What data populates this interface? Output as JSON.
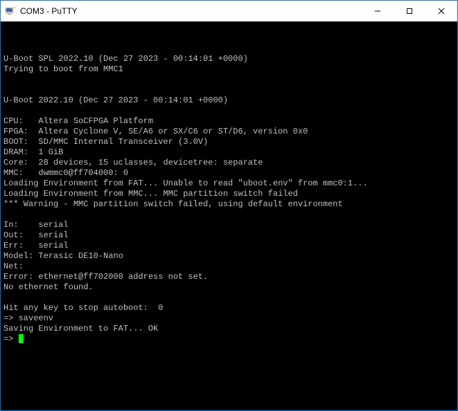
{
  "window": {
    "title": "COM3 - PuTTY"
  },
  "terminal": {
    "lines": [
      "",
      "U-Boot SPL 2022.10 (Dec 27 2023 - 00:14:01 +0000)",
      "Trying to boot from MMC1",
      "",
      "",
      "U-Boot 2022.10 (Dec 27 2023 - 00:14:01 +0000)",
      "",
      "CPU:   Altera SoCFPGA Platform",
      "FPGA:  Altera Cyclone V, SE/A6 or SX/C6 or ST/D6, version 0x0",
      "BOOT:  SD/MMC Internal Transceiver (3.0V)",
      "DRAM:  1 GiB",
      "Core:  28 devices, 15 uclasses, devicetree: separate",
      "MMC:   dwmmc0@ff704000: 0",
      "Loading Environment from FAT... Unable to read \"uboot.env\" from mmc0:1...",
      "Loading Environment from MMC... MMC partition switch failed",
      "*** Warning - MMC partition switch failed, using default environment",
      "",
      "In:    serial",
      "Out:   serial",
      "Err:   serial",
      "Model: Terasic DE10-Nano",
      "Net:",
      "Error: ethernet@ff702000 address not set.",
      "No ethernet found.",
      "",
      "Hit any key to stop autoboot:  0",
      "=> saveenv",
      "Saving Environment to FAT... OK"
    ],
    "prompt": "=> "
  }
}
